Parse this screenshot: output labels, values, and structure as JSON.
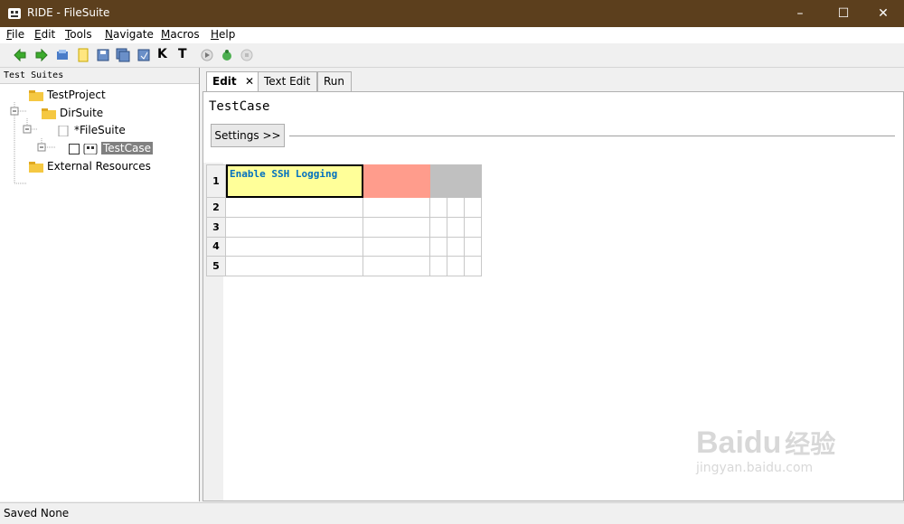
{
  "window": {
    "title": "RIDE - FileSuite"
  },
  "menubar": {
    "items": [
      "File",
      "Edit",
      "Tools",
      "Navigate",
      "Macros",
      "Help"
    ],
    "mnemonics": [
      "F",
      "E",
      "T",
      "N",
      "M",
      "H"
    ]
  },
  "toolbar": {
    "icons": [
      "back-arrow-icon",
      "forward-arrow-icon",
      "open-icon",
      "new-file-icon",
      "save-icon",
      "save-all-icon",
      "save-as-icon",
      "search-keyword-icon",
      "search-test-icon",
      "run-icon",
      "debug-icon",
      "stop-icon"
    ],
    "labels": {
      "k": "K",
      "t": "T"
    }
  },
  "tree": {
    "header": "Test Suites",
    "nodes": [
      {
        "label": "TestProject"
      },
      {
        "label": "DirSuite"
      },
      {
        "label": "*FileSuite"
      },
      {
        "label": "TestCase"
      },
      {
        "label": "External Resources"
      }
    ]
  },
  "tabs": [
    {
      "label": "Edit"
    },
    {
      "label": "Text Edit"
    },
    {
      "label": "Run"
    }
  ],
  "editor": {
    "title": "TestCase",
    "settings_button": "Settings >>",
    "grid": {
      "row_numbers": [
        "1",
        "2",
        "3",
        "4",
        "5"
      ],
      "cell_1_1": "Enable SSH Logging"
    }
  },
  "colors": {
    "titlebar": "#5c3f1d",
    "keyword_cell": "#ffff99",
    "error_cell": "#ff9c8c",
    "keyword_text": "#0070c0"
  },
  "statusbar": {
    "text": "Saved None"
  },
  "watermark": {
    "brand": "Baidu",
    "brand_cn": "经验",
    "url": "jingyan.baidu.com"
  }
}
